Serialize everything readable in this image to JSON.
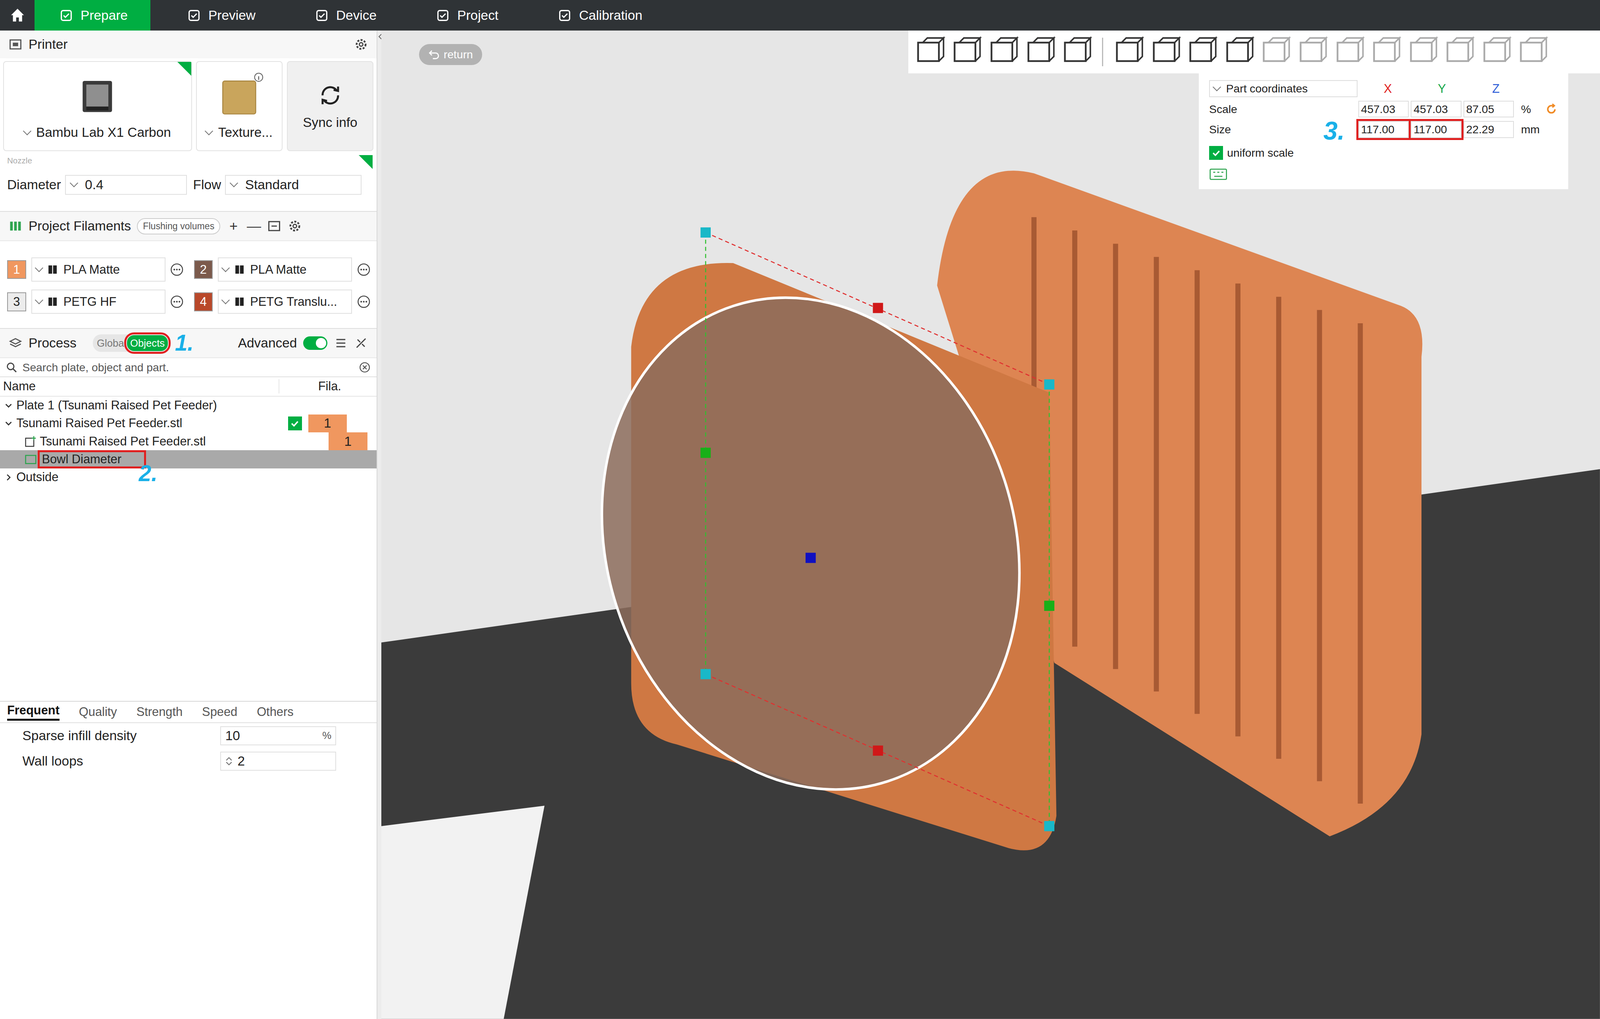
{
  "nav": {
    "tabs": [
      {
        "label": "Prepare",
        "selected": true
      },
      {
        "label": "Preview",
        "selected": false
      },
      {
        "label": "Device",
        "selected": false
      },
      {
        "label": "Project",
        "selected": false
      },
      {
        "label": "Calibration",
        "selected": false
      }
    ]
  },
  "printer": {
    "title": "Printer",
    "name": "Bambu Lab X1 Carbon",
    "plate": "Texture...",
    "sync": "Sync info",
    "nozzle_label": "Nozzle",
    "diameter_label": "Diameter",
    "diameter": "0.4",
    "flow_label": "Flow",
    "flow": "Standard"
  },
  "filaments": {
    "title": "Project Filaments",
    "flushing": "Flushing volumes",
    "add": "+",
    "remove": "—",
    "items": [
      {
        "num": "1",
        "name": "PLA Matte",
        "color": "#f0975f"
      },
      {
        "num": "2",
        "name": "PLA Matte",
        "color": "#7b5a4c"
      },
      {
        "num": "3",
        "name": "PETG HF",
        "color": "#ececec"
      },
      {
        "num": "4",
        "name": "PETG Translu...",
        "color": "#b9482a"
      }
    ]
  },
  "process": {
    "title": "Process",
    "modes": [
      {
        "label": "Globa",
        "selected": false,
        "annotated": false
      },
      {
        "label": "Objects",
        "selected": true,
        "annotated": true
      }
    ],
    "annotation": "1.",
    "advanced_label": "Advanced",
    "advanced_on": true
  },
  "search": {
    "placeholder": "Search plate, object and part."
  },
  "tree": {
    "columns": [
      "Name",
      "Fila."
    ],
    "rows": [
      {
        "label": "Plate 1 (Tsunami Raised Pet Feeder)",
        "kind": "plate",
        "depth": 0,
        "expanded": true,
        "selected": false,
        "annotated": false
      },
      {
        "label": "Tsunami Raised Pet Feeder.stl",
        "kind": "object",
        "depth": 0,
        "expanded": true,
        "selected": false,
        "annotated": false,
        "checked": true,
        "fila": "1",
        "fila_color": "#f0975f"
      },
      {
        "label": "Tsunami Raised Pet Feeder.stl",
        "kind": "part",
        "depth": 1,
        "selected": false,
        "annotated": false,
        "fila": "1",
        "fila_color": "#f0975f"
      },
      {
        "label": "Bowl Diameter",
        "kind": "modifier",
        "depth": 1,
        "selected": true,
        "annotated": true,
        "annotation": "2."
      },
      {
        "label": "Outside",
        "kind": "group",
        "depth": 0,
        "expanded": false,
        "selected": false,
        "annotated": false
      }
    ]
  },
  "settings": {
    "tabs": [
      {
        "label": "Frequent",
        "selected": true
      },
      {
        "label": "Quality",
        "selected": false
      },
      {
        "label": "Strength",
        "selected": false
      },
      {
        "label": "Speed",
        "selected": false
      },
      {
        "label": "Others",
        "selected": false
      }
    ],
    "rows": [
      {
        "label": "Sparse infill density",
        "value": "10",
        "unit": "%",
        "kind": "unit"
      },
      {
        "label": "Wall loops",
        "value": "2",
        "kind": "spin"
      }
    ]
  },
  "viewport": {
    "return": "return",
    "coords": {
      "mode": "Part coordinates",
      "axes": [
        {
          "label": "X",
          "color": "#e02020"
        },
        {
          "label": "Y",
          "color": "#18a84a"
        },
        {
          "label": "Z",
          "color": "#2f5fd8"
        }
      ],
      "rows": [
        {
          "label": "Scale",
          "values": [
            {
              "text": "457.03",
              "annotated": false
            },
            {
              "text": "457.03",
              "annotated": false
            },
            {
              "text": "87.05",
              "annotated": false
            }
          ],
          "unit": "%"
        },
        {
          "label": "Size",
          "values": [
            {
              "text": "117.00",
              "annotated": true
            },
            {
              "text": "117.00",
              "annotated": true
            },
            {
              "text": "22.29",
              "annotated": false
            }
          ],
          "unit": "mm"
        }
      ],
      "annotation": "3.",
      "uniform_label": "uniform scale",
      "uniform_checked": true
    }
  }
}
